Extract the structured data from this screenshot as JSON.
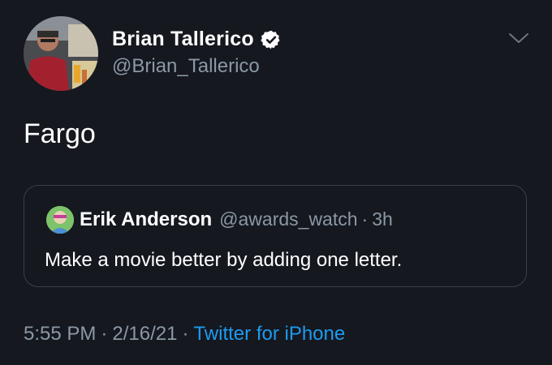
{
  "author": {
    "name": "Brian Tallerico",
    "handle": "@Brian_Tallerico",
    "verified": true
  },
  "tweet": {
    "text": "Fargo"
  },
  "quoted_tweet": {
    "name": "Erik Anderson",
    "handle": "@awards_watch",
    "separator": "·",
    "time": "3h",
    "text": "Make a movie better by adding one letter."
  },
  "footer": {
    "time": "5:55 PM",
    "date": "2/16/21",
    "separator": "·",
    "source": "Twitter for iPhone"
  },
  "icons": {
    "verified": "verified-badge-icon",
    "menu": "chevron-down-icon"
  },
  "colors": {
    "background": "#15181f",
    "link": "#1d9bf0",
    "secondary_text": "#8b98a5",
    "border": "#3a3f47"
  }
}
